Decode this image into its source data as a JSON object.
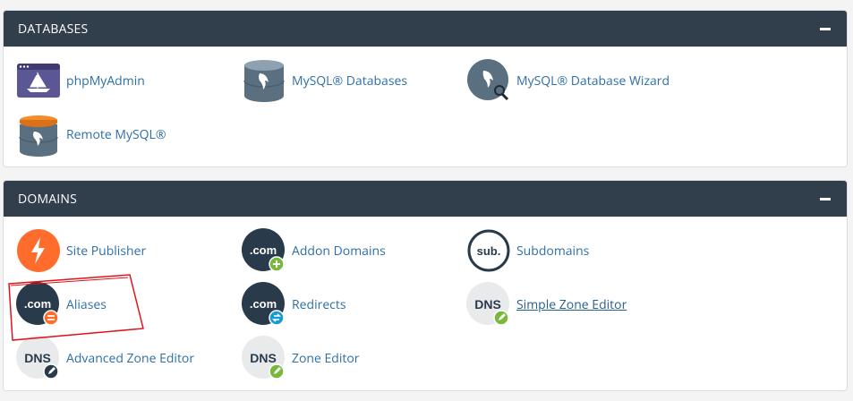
{
  "databases": {
    "title": "DATABASES",
    "items": [
      {
        "label": "phpMyAdmin",
        "icon": "phpmyadmin-icon"
      },
      {
        "label": "MySQL® Databases",
        "icon": "mysql-databases-icon"
      },
      {
        "label": "MySQL® Database Wizard",
        "icon": "mysql-database-wizard-icon"
      },
      {
        "label": "Remote MySQL®",
        "icon": "remote-mysql-icon"
      }
    ]
  },
  "domains": {
    "title": "DOMAINS",
    "items": [
      {
        "label": "Site Publisher",
        "icon": "site-publisher-icon"
      },
      {
        "label": "Addon Domains",
        "icon": "addon-domains-icon",
        "icon_text": ".com"
      },
      {
        "label": "Subdomains",
        "icon": "subdomains-icon",
        "icon_text": "sub."
      },
      {
        "label": "Aliases",
        "icon": "aliases-icon",
        "icon_text": ".com"
      },
      {
        "label": "Redirects",
        "icon": "redirects-icon",
        "icon_text": ".com"
      },
      {
        "label": "Simple Zone Editor",
        "icon": "simple-zone-editor-icon",
        "icon_text": "DNS"
      },
      {
        "label": "Advanced Zone Editor",
        "icon": "advanced-zone-editor-icon",
        "icon_text": "DNS"
      },
      {
        "label": "Zone Editor",
        "icon": "zone-editor-icon",
        "icon_text": "DNS"
      }
    ]
  },
  "colors": {
    "header_bg": "#313f4d",
    "link": "#2c6ea8",
    "accent_orange": "#ff6c2c",
    "dark_icon": "#293a4a",
    "green_badge": "#79b83c",
    "blue_badge": "#179bd7",
    "annotation_red": "#e0141b"
  }
}
